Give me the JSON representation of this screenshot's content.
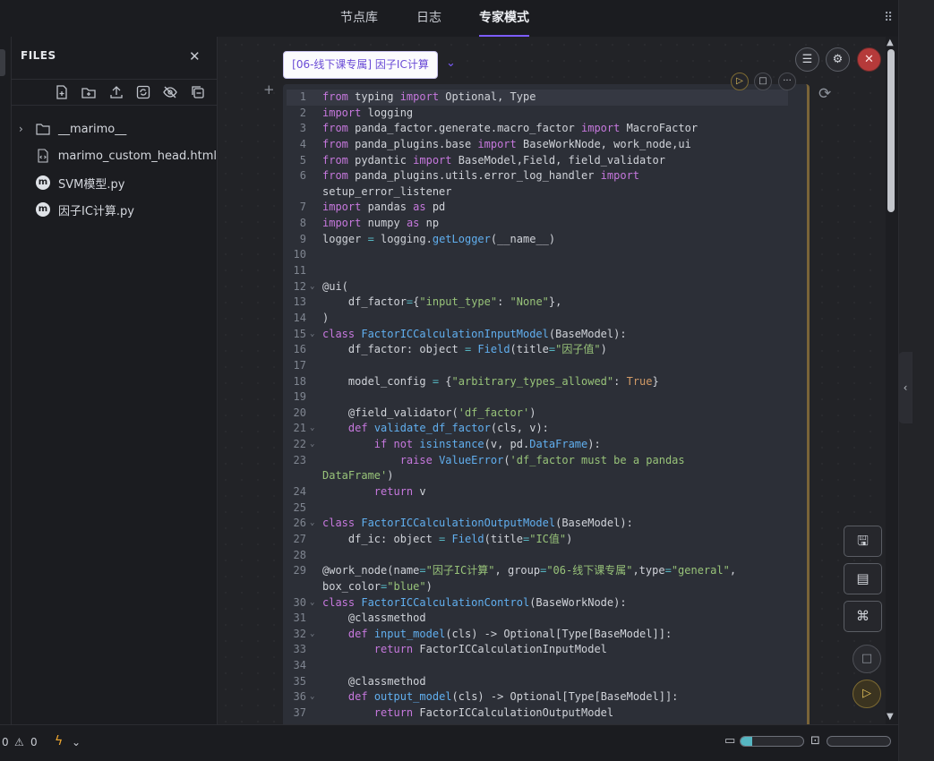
{
  "topbar": {
    "tabs": [
      {
        "label": "节点库"
      },
      {
        "label": "日志"
      },
      {
        "label": "专家模式",
        "active": true
      }
    ]
  },
  "files": {
    "title": "FILES",
    "toolbar_icons": [
      "new-file-icon",
      "new-folder-icon",
      "upload-icon",
      "refresh-icon",
      "hide-icon",
      "collapse-icon"
    ],
    "items": [
      {
        "label": "__marimo__",
        "type": "folder"
      },
      {
        "label": "marimo_custom_head.html",
        "type": "html"
      },
      {
        "label": "SVM模型.py",
        "type": "marimo"
      },
      {
        "label": "因子IC计算.py",
        "type": "marimo"
      }
    ]
  },
  "node": {
    "chip_label": "[06-线下课专属] 因子IC计算"
  },
  "code_lines": [
    {
      "n": "1",
      "fold": false,
      "html": "<span class=\"k\">from</span> typing <span class=\"k\">import</span> Optional, Type"
    },
    {
      "n": "2",
      "fold": false,
      "html": "<span class=\"k\">import</span> logging"
    },
    {
      "n": "3",
      "fold": false,
      "html": "<span class=\"k\">from</span> panda_factor.generate.macro_factor <span class=\"k\">import</span> MacroFactor"
    },
    {
      "n": "4",
      "fold": false,
      "html": "<span class=\"k\">from</span> panda_plugins.base <span class=\"k\">import</span> BaseWorkNode, work_node,ui"
    },
    {
      "n": "5",
      "fold": false,
      "html": "<span class=\"k\">from</span> pydantic <span class=\"k\">import</span> BaseModel,Field, field_validator"
    },
    {
      "n": "6",
      "fold": false,
      "html": "<span class=\"k\">from</span> panda_plugins.utils.error_log_handler <span class=\"k\">import</span>"
    },
    {
      "n": "",
      "fold": false,
      "html": "setup_error_listener"
    },
    {
      "n": "7",
      "fold": false,
      "html": "<span class=\"k\">import</span> pandas <span class=\"k\">as</span> pd"
    },
    {
      "n": "8",
      "fold": false,
      "html": "<span class=\"k\">import</span> numpy <span class=\"k\">as</span> np"
    },
    {
      "n": "9",
      "fold": false,
      "html": "logger <span class=\"o\">=</span> logging.<span class=\"f\">getLogger</span>(__name__)"
    },
    {
      "n": "10",
      "fold": false,
      "html": ""
    },
    {
      "n": "11",
      "fold": false,
      "html": ""
    },
    {
      "n": "12",
      "fold": true,
      "html": "@ui("
    },
    {
      "n": "13",
      "fold": false,
      "html": "    df_factor<span class=\"o\">=</span>{<span class=\"s\">\"input_type\"</span>: <span class=\"s\">\"None\"</span>},"
    },
    {
      "n": "14",
      "fold": false,
      "html": ")"
    },
    {
      "n": "15",
      "fold": true,
      "html": "<span class=\"k\">class</span> <span class=\"f\">FactorICCalculationInputModel</span>(BaseModel):"
    },
    {
      "n": "16",
      "fold": false,
      "html": "    df_factor: object <span class=\"o\">=</span> <span class=\"f\">Field</span>(title<span class=\"o\">=</span><span class=\"s\">\"因子值\"</span>)"
    },
    {
      "n": "17",
      "fold": false,
      "html": ""
    },
    {
      "n": "18",
      "fold": false,
      "html": "    model_config <span class=\"o\">=</span> {<span class=\"s\">\"arbitrary_types_allowed\"</span>: <span class=\"c\">True</span>}"
    },
    {
      "n": "19",
      "fold": false,
      "html": ""
    },
    {
      "n": "20",
      "fold": false,
      "html": "    @field_validator(<span class=\"s\">'df_factor'</span>)"
    },
    {
      "n": "21",
      "fold": true,
      "html": "    <span class=\"k\">def</span> <span class=\"f\">validate_df_factor</span>(cls, v):"
    },
    {
      "n": "22",
      "fold": true,
      "html": "        <span class=\"k\">if</span> <span class=\"k\">not</span> <span class=\"f\">isinstance</span>(v, pd.<span class=\"f\">DataFrame</span>):"
    },
    {
      "n": "23",
      "fold": false,
      "html": "            <span class=\"k\">raise</span> <span class=\"f\">ValueError</span>(<span class=\"s\">'df_factor must be a pandas</span>"
    },
    {
      "n": "",
      "fold": false,
      "html": "<span class=\"s\">DataFrame'</span>)"
    },
    {
      "n": "24",
      "fold": false,
      "html": "        <span class=\"k\">return</span> v"
    },
    {
      "n": "25",
      "fold": false,
      "html": ""
    },
    {
      "n": "26",
      "fold": true,
      "html": "<span class=\"k\">class</span> <span class=\"f\">FactorICCalculationOutputModel</span>(BaseModel):"
    },
    {
      "n": "27",
      "fold": false,
      "html": "    df_ic: object <span class=\"o\">=</span> <span class=\"f\">Field</span>(title<span class=\"o\">=</span><span class=\"s\">\"IC值\"</span>)"
    },
    {
      "n": "28",
      "fold": false,
      "html": ""
    },
    {
      "n": "29",
      "fold": false,
      "html": "@work_node(name<span class=\"o\">=</span><span class=\"s\">\"因子IC计算\"</span>, group<span class=\"o\">=</span><span class=\"s\">\"06-线下课专属\"</span>,type<span class=\"o\">=</span><span class=\"s\">\"general\"</span>,"
    },
    {
      "n": "",
      "fold": false,
      "html": "box_color<span class=\"o\">=</span><span class=\"s\">\"blue\"</span>)"
    },
    {
      "n": "30",
      "fold": true,
      "html": "<span class=\"k\">class</span> <span class=\"f\">FactorICCalculationControl</span>(BaseWorkNode):"
    },
    {
      "n": "31",
      "fold": false,
      "html": "    @classmethod"
    },
    {
      "n": "32",
      "fold": true,
      "html": "    <span class=\"k\">def</span> <span class=\"f\">input_model</span>(cls) -&gt; Optional[Type[BaseModel]]:"
    },
    {
      "n": "33",
      "fold": false,
      "html": "        <span class=\"k\">return</span> FactorICCalculationInputModel"
    },
    {
      "n": "34",
      "fold": false,
      "html": ""
    },
    {
      "n": "35",
      "fold": false,
      "html": "    @classmethod"
    },
    {
      "n": "36",
      "fold": true,
      "html": "    <span class=\"k\">def</span> <span class=\"f\">output_model</span>(cls) -&gt; Optional[Type[BaseModel]]:"
    },
    {
      "n": "37",
      "fold": false,
      "html": "        <span class=\"k\">return</span> FactorICCalculationOutputModel"
    }
  ],
  "status": {
    "errors": "0",
    "warnings": "0"
  },
  "colors": {
    "accent": "#7c5cff",
    "keyword": "#c678dd",
    "string": "#98c379",
    "function": "#61afef",
    "run": "#e5c35c"
  },
  "status_meters": {
    "memory_fraction": 0.18,
    "cpu_fraction": 0.0
  }
}
